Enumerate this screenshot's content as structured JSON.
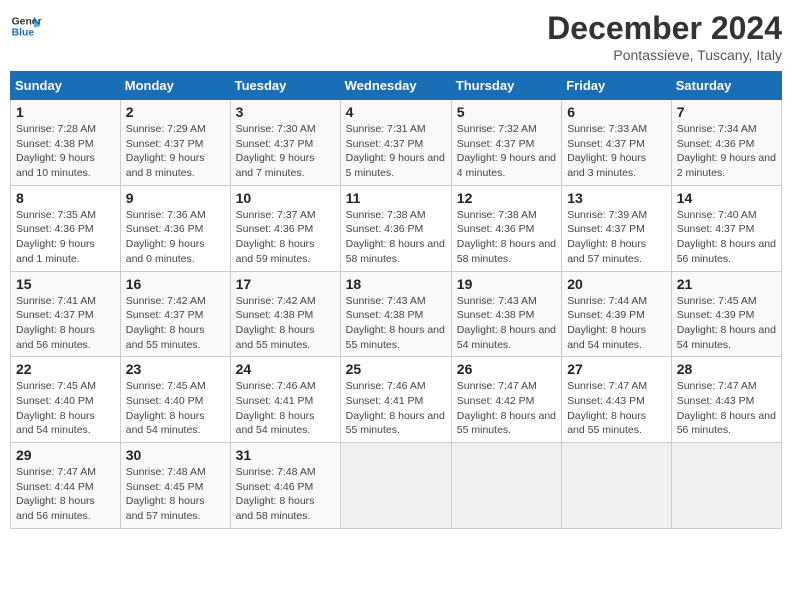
{
  "logo": {
    "line1": "General",
    "line2": "Blue"
  },
  "title": "December 2024",
  "subtitle": "Pontassieve, Tuscany, Italy",
  "weekdays": [
    "Sunday",
    "Monday",
    "Tuesday",
    "Wednesday",
    "Thursday",
    "Friday",
    "Saturday"
  ],
  "weeks": [
    [
      {
        "day": "1",
        "sunrise": "7:28 AM",
        "sunset": "4:38 PM",
        "daylight": "9 hours and 10 minutes."
      },
      {
        "day": "2",
        "sunrise": "7:29 AM",
        "sunset": "4:37 PM",
        "daylight": "9 hours and 8 minutes."
      },
      {
        "day": "3",
        "sunrise": "7:30 AM",
        "sunset": "4:37 PM",
        "daylight": "9 hours and 7 minutes."
      },
      {
        "day": "4",
        "sunrise": "7:31 AM",
        "sunset": "4:37 PM",
        "daylight": "9 hours and 5 minutes."
      },
      {
        "day": "5",
        "sunrise": "7:32 AM",
        "sunset": "4:37 PM",
        "daylight": "9 hours and 4 minutes."
      },
      {
        "day": "6",
        "sunrise": "7:33 AM",
        "sunset": "4:37 PM",
        "daylight": "9 hours and 3 minutes."
      },
      {
        "day": "7",
        "sunrise": "7:34 AM",
        "sunset": "4:36 PM",
        "daylight": "9 hours and 2 minutes."
      }
    ],
    [
      {
        "day": "8",
        "sunrise": "7:35 AM",
        "sunset": "4:36 PM",
        "daylight": "9 hours and 1 minute."
      },
      {
        "day": "9",
        "sunrise": "7:36 AM",
        "sunset": "4:36 PM",
        "daylight": "9 hours and 0 minutes."
      },
      {
        "day": "10",
        "sunrise": "7:37 AM",
        "sunset": "4:36 PM",
        "daylight": "8 hours and 59 minutes."
      },
      {
        "day": "11",
        "sunrise": "7:38 AM",
        "sunset": "4:36 PM",
        "daylight": "8 hours and 58 minutes."
      },
      {
        "day": "12",
        "sunrise": "7:38 AM",
        "sunset": "4:36 PM",
        "daylight": "8 hours and 58 minutes."
      },
      {
        "day": "13",
        "sunrise": "7:39 AM",
        "sunset": "4:37 PM",
        "daylight": "8 hours and 57 minutes."
      },
      {
        "day": "14",
        "sunrise": "7:40 AM",
        "sunset": "4:37 PM",
        "daylight": "8 hours and 56 minutes."
      }
    ],
    [
      {
        "day": "15",
        "sunrise": "7:41 AM",
        "sunset": "4:37 PM",
        "daylight": "8 hours and 56 minutes."
      },
      {
        "day": "16",
        "sunrise": "7:42 AM",
        "sunset": "4:37 PM",
        "daylight": "8 hours and 55 minutes."
      },
      {
        "day": "17",
        "sunrise": "7:42 AM",
        "sunset": "4:38 PM",
        "daylight": "8 hours and 55 minutes."
      },
      {
        "day": "18",
        "sunrise": "7:43 AM",
        "sunset": "4:38 PM",
        "daylight": "8 hours and 55 minutes."
      },
      {
        "day": "19",
        "sunrise": "7:43 AM",
        "sunset": "4:38 PM",
        "daylight": "8 hours and 54 minutes."
      },
      {
        "day": "20",
        "sunrise": "7:44 AM",
        "sunset": "4:39 PM",
        "daylight": "8 hours and 54 minutes."
      },
      {
        "day": "21",
        "sunrise": "7:45 AM",
        "sunset": "4:39 PM",
        "daylight": "8 hours and 54 minutes."
      }
    ],
    [
      {
        "day": "22",
        "sunrise": "7:45 AM",
        "sunset": "4:40 PM",
        "daylight": "8 hours and 54 minutes."
      },
      {
        "day": "23",
        "sunrise": "7:45 AM",
        "sunset": "4:40 PM",
        "daylight": "8 hours and 54 minutes."
      },
      {
        "day": "24",
        "sunrise": "7:46 AM",
        "sunset": "4:41 PM",
        "daylight": "8 hours and 54 minutes."
      },
      {
        "day": "25",
        "sunrise": "7:46 AM",
        "sunset": "4:41 PM",
        "daylight": "8 hours and 55 minutes."
      },
      {
        "day": "26",
        "sunrise": "7:47 AM",
        "sunset": "4:42 PM",
        "daylight": "8 hours and 55 minutes."
      },
      {
        "day": "27",
        "sunrise": "7:47 AM",
        "sunset": "4:43 PM",
        "daylight": "8 hours and 55 minutes."
      },
      {
        "day": "28",
        "sunrise": "7:47 AM",
        "sunset": "4:43 PM",
        "daylight": "8 hours and 56 minutes."
      }
    ],
    [
      {
        "day": "29",
        "sunrise": "7:47 AM",
        "sunset": "4:44 PM",
        "daylight": "8 hours and 56 minutes."
      },
      {
        "day": "30",
        "sunrise": "7:48 AM",
        "sunset": "4:45 PM",
        "daylight": "8 hours and 57 minutes."
      },
      {
        "day": "31",
        "sunrise": "7:48 AM",
        "sunset": "4:46 PM",
        "daylight": "8 hours and 58 minutes."
      },
      null,
      null,
      null,
      null
    ]
  ],
  "labels": {
    "sunrise": "Sunrise:",
    "sunset": "Sunset:",
    "daylight": "Daylight:"
  }
}
